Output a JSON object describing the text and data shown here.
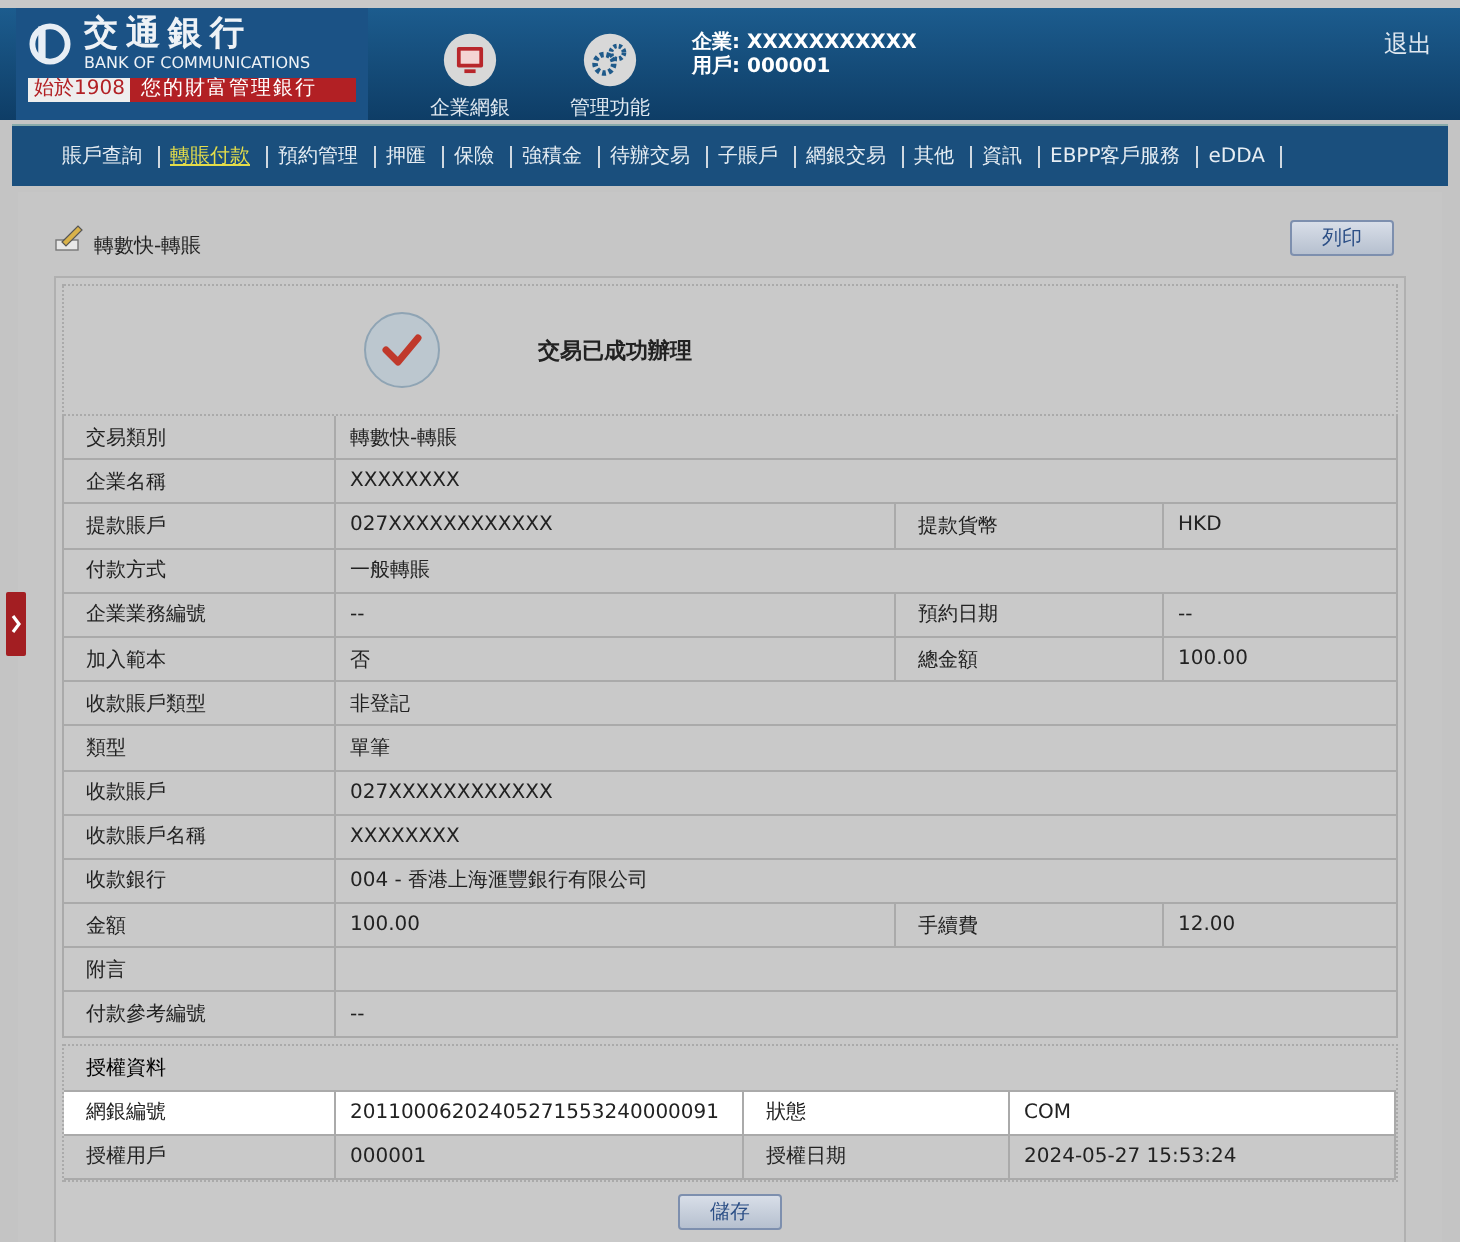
{
  "header": {
    "logo": {
      "name_zh": "交通銀行",
      "name_en": "BANK OF COMMUNICATIONS",
      "since": "始於1908",
      "slogan": "您的財富管理銀行"
    },
    "apps": [
      {
        "kind": "monitor",
        "label": "企業網銀"
      },
      {
        "kind": "gears",
        "label": "管理功能"
      }
    ],
    "user_lines": [
      "企業: XXXXXXXXXXX",
      "用戶: 000001"
    ],
    "logout": "退出"
  },
  "nav": [
    {
      "label": "賬戶查詢",
      "selected": false
    },
    {
      "label": "轉賬付款",
      "selected": true
    },
    {
      "label": "預約管理",
      "selected": false
    },
    {
      "label": "押匯",
      "selected": false
    },
    {
      "label": "保險",
      "selected": false
    },
    {
      "label": "強積金",
      "selected": false
    },
    {
      "label": "待辦交易",
      "selected": false
    },
    {
      "label": "子賬戶",
      "selected": false
    },
    {
      "label": "網銀交易",
      "selected": false
    },
    {
      "label": "其他",
      "selected": false
    },
    {
      "label": "資訊",
      "selected": false
    },
    {
      "label": "EBPP客戶服務",
      "selected": false
    },
    {
      "label": "eDDA",
      "selected": false
    }
  ],
  "page_title": "轉數快-轉賬",
  "print_button": "列印",
  "result_message": "交易已成功辦理",
  "details": [
    {
      "cells": [
        {
          "label": "交易類別",
          "value": "轉數快-轉賬"
        }
      ]
    },
    {
      "cells": [
        {
          "label": "企業名稱",
          "value": "XXXXXXXX"
        }
      ]
    },
    {
      "cells": [
        {
          "label": "提款賬戶",
          "value": "027XXXXXXXXXXXX"
        },
        {
          "label": "提款貨幣",
          "value": "HKD"
        }
      ]
    },
    {
      "cells": [
        {
          "label": "付款方式",
          "value": "一般轉賬"
        }
      ]
    },
    {
      "cells": [
        {
          "label": "企業業務編號",
          "value": "--"
        },
        {
          "label": "預約日期",
          "value": "--"
        }
      ]
    },
    {
      "cells": [
        {
          "label": "加入範本",
          "value": "否"
        },
        {
          "label": "總金額",
          "value": "100.00"
        }
      ]
    },
    {
      "cells": [
        {
          "label": "收款賬戶類型",
          "value": "非登記"
        }
      ]
    },
    {
      "cells": [
        {
          "label": "類型",
          "value": "單筆"
        }
      ]
    },
    {
      "cells": [
        {
          "label": "收款賬戶",
          "value": "027XXXXXXXXXXXX"
        }
      ]
    },
    {
      "cells": [
        {
          "label": "收款賬戶名稱",
          "value": "XXXXXXXX"
        }
      ]
    },
    {
      "cells": [
        {
          "label": "收款銀行",
          "value": "004 - 香港上海滙豐銀行有限公司"
        }
      ]
    },
    {
      "cells": [
        {
          "label": "金額",
          "value": "100.00"
        },
        {
          "label": "手續費",
          "value": "12.00"
        }
      ]
    },
    {
      "cells": [
        {
          "label": "附言"
        }
      ]
    },
    {
      "cells": [
        {
          "label": "付款參考編號",
          "value": "--"
        }
      ]
    }
  ],
  "authorization": {
    "title": "授權資料",
    "rows": [
      {
        "highlighted": true,
        "cells": [
          {
            "label": "網銀編號",
            "value": "20110006202405271553240000091"
          },
          {
            "label": "狀態",
            "value": "COM"
          }
        ]
      },
      {
        "highlighted": false,
        "cells": [
          {
            "label": "授權用戶",
            "value": "000001"
          },
          {
            "label": "授權日期",
            "value": "2024-05-27 15:53:24"
          }
        ]
      }
    ]
  },
  "save_button": "儲存"
}
